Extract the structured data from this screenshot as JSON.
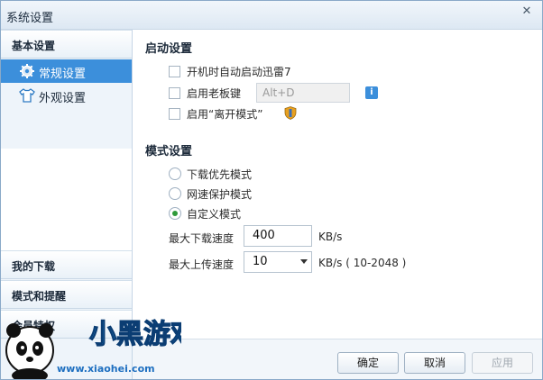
{
  "window": {
    "title": "系统设置",
    "close_glyph": "✕"
  },
  "sidebar": {
    "basic_header": "基本设置",
    "items": [
      {
        "label": "常规设置",
        "active": true,
        "icon": "gear-icon"
      },
      {
        "label": "外观设置",
        "active": false,
        "icon": "shirt-icon"
      }
    ],
    "sections": [
      {
        "label": "我的下载"
      },
      {
        "label": "模式和提醒"
      },
      {
        "label": "会员特权"
      }
    ]
  },
  "startup": {
    "title": "启动设置",
    "options": [
      {
        "label": "开机时自动启动迅雷7",
        "checked": false
      },
      {
        "label": "启用老板键",
        "checked": false
      },
      {
        "label": "启用“离开模式”",
        "checked": false
      }
    ],
    "hotkey_value": "Alt+D",
    "info_glyph": "i"
  },
  "mode": {
    "title": "模式设置",
    "options": [
      {
        "label": "下载优先模式",
        "selected": false
      },
      {
        "label": "网速保护模式",
        "selected": false
      },
      {
        "label": "自定义模式",
        "selected": true
      }
    ],
    "max_download_label": "最大下载速度",
    "max_download_value": "400",
    "max_download_unit": "KB/s",
    "max_upload_label": "最大上传速度",
    "max_upload_value": "10",
    "max_upload_unit": "KB/s ( 10-2048 )"
  },
  "footer": {
    "ok_label": "确定",
    "cancel_label": "取消",
    "apply_label": "应用"
  },
  "watermark": {
    "brand_text": "小黑游戏",
    "url_text": "www.xiaohei.com"
  },
  "colors": {
    "accent": "#3c8fdb",
    "radio_checked": "#2f9a3a",
    "shield": "#e8a020"
  }
}
